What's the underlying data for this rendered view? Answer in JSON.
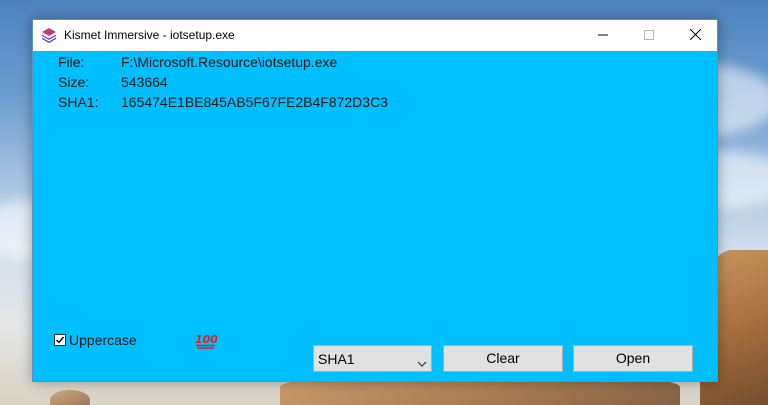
{
  "window": {
    "title": "Kismet Immersive - iotsetup.exe",
    "background_color": "#00bfff",
    "app_icon": "kismet-stack-icon"
  },
  "titlebar_buttons": {
    "minimize_icon": "minimize-icon",
    "maximize_icon": "maximize-icon",
    "close_icon": "close-icon"
  },
  "file_info": {
    "file_label": "File:",
    "file_value": "F:\\Microsoft.Resource\\iotsetup.exe",
    "size_label": "Size:",
    "size_value": "543664",
    "hash_label": "SHA1:",
    "hash_value": "165474E1BE845AB5F67FE2B4F872D3C3"
  },
  "controls": {
    "uppercase_label": "Uppercase",
    "uppercase_checked": true,
    "emoji_icon": "hundred-points-icon",
    "algorithm_selected": "SHA1",
    "clear_label": "Clear",
    "open_label": "Open"
  }
}
